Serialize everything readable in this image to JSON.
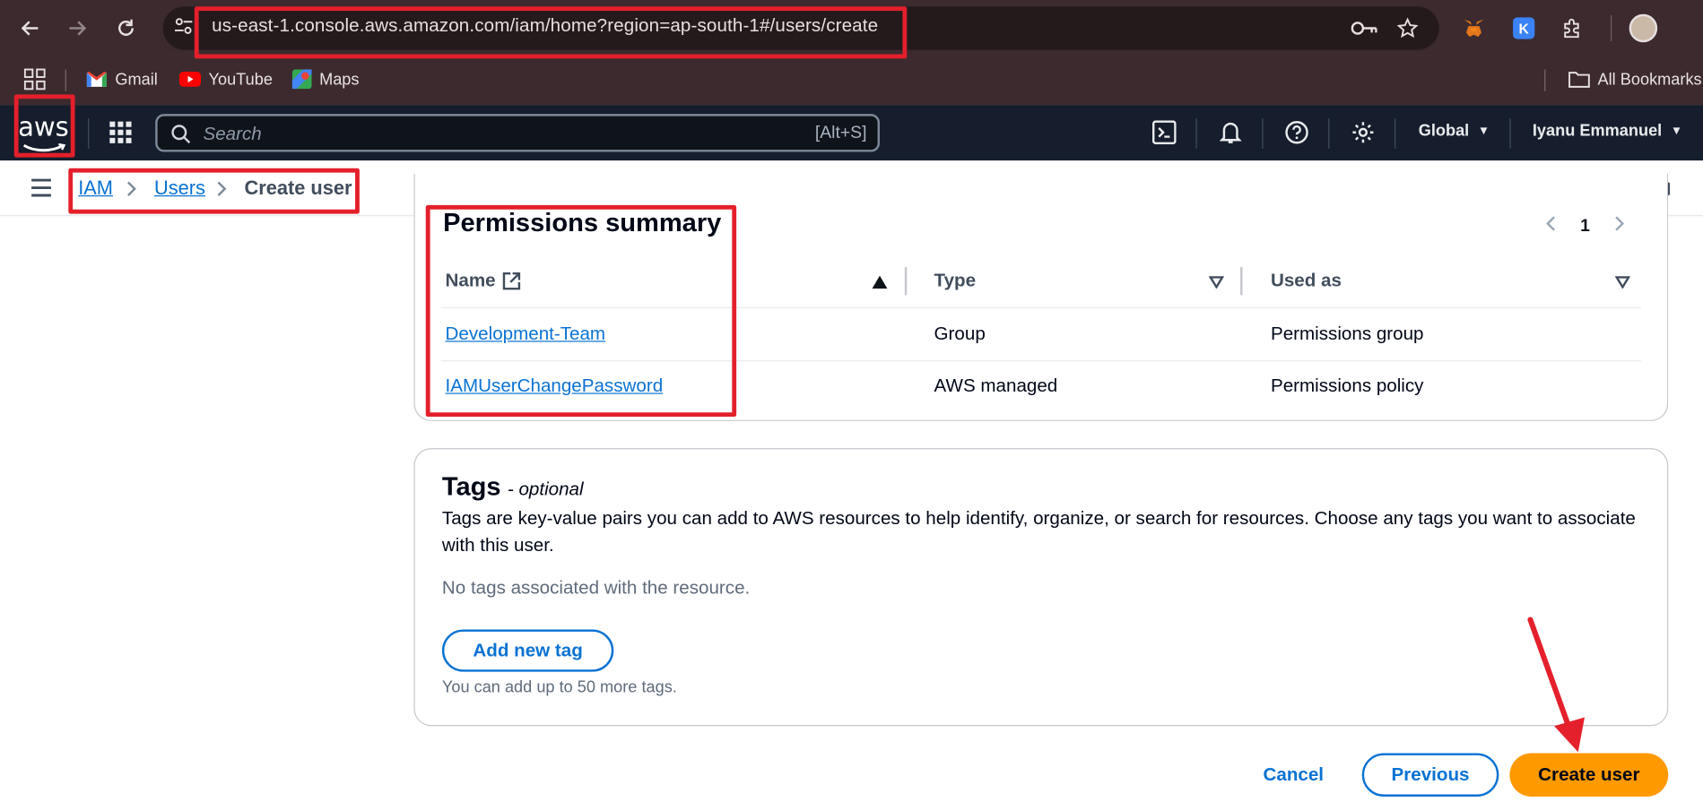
{
  "browser": {
    "url": "us-east-1.console.aws.amazon.com/iam/home?region=ap-south-1#/users/create",
    "bookmarks": [
      {
        "label": "Gmail",
        "icon": "gmail-icon"
      },
      {
        "label": "YouTube",
        "icon": "youtube-icon"
      },
      {
        "label": "Maps",
        "icon": "maps-icon"
      }
    ],
    "all_bookmarks_label": "All Bookmarks",
    "extension_badge": "K"
  },
  "aws_nav": {
    "logo_text": "aws",
    "search_placeholder": "Search",
    "search_shortcut": "[Alt+S]",
    "region_label": "Global",
    "user_label": "Iyanu Emmanuel"
  },
  "breadcrumb": {
    "items": [
      "IAM",
      "Users",
      "Create user"
    ]
  },
  "permissions": {
    "title": "Permissions summary",
    "page_number": "1",
    "columns": [
      "Name",
      "Type",
      "Used as"
    ],
    "rows": [
      {
        "name": "Development-Team",
        "type": "Group",
        "used_as": "Permissions group"
      },
      {
        "name": "IAMUserChangePassword",
        "type": "AWS managed",
        "used_as": "Permissions policy"
      }
    ]
  },
  "tags": {
    "title": "Tags",
    "optional": "- optional",
    "description": "Tags are key-value pairs you can add to AWS resources to help identify, organize, or search for resources. Choose any tags you want to associate with this user.",
    "empty_text": "No tags associated with the resource.",
    "add_button": "Add new tag",
    "limit_text": "You can add up to 50 more tags."
  },
  "footer": {
    "cancel_label": "Cancel",
    "previous_label": "Previous",
    "create_label": "Create user"
  },
  "colors": {
    "aws_nav_bg": "#161e2d",
    "link_blue": "#0972d3",
    "primary_orange": "#ff9900",
    "annotation_red": "#e3202b"
  }
}
